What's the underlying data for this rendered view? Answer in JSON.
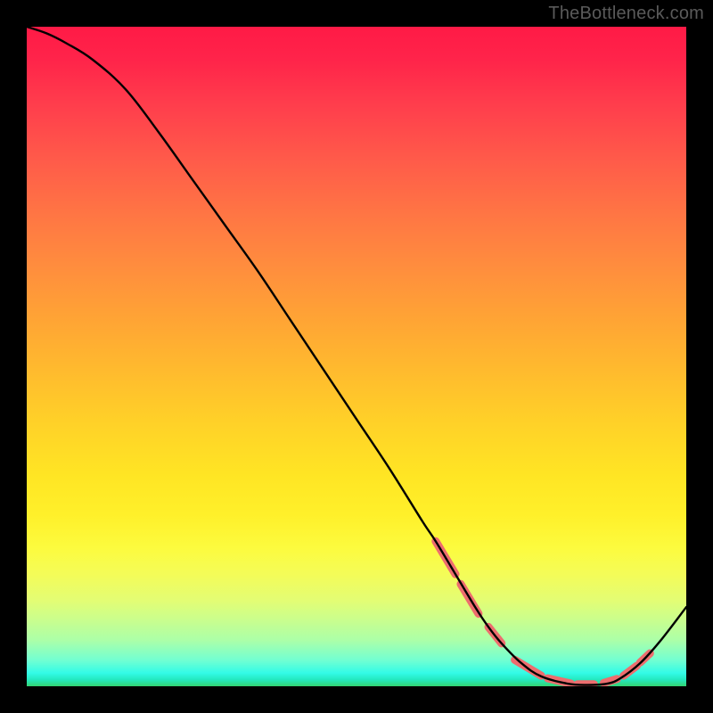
{
  "attribution": "TheBottleneck.com",
  "chart_data": {
    "type": "line",
    "title": "",
    "xlabel": "",
    "ylabel": "",
    "xlim": [
      0,
      100
    ],
    "ylim": [
      0,
      100
    ],
    "series": [
      {
        "name": "curve",
        "x": [
          0,
          3,
          6,
          10,
          15,
          20,
          25,
          30,
          35,
          40,
          45,
          50,
          55,
          60,
          62,
          65,
          68,
          70,
          72,
          75,
          78,
          82,
          85,
          88,
          90,
          93,
          96,
          100
        ],
        "y": [
          100,
          99,
          97.5,
          95,
          90.5,
          84,
          77,
          70,
          63,
          55.5,
          48,
          40.5,
          33,
          25,
          22,
          17,
          12,
          9,
          6.5,
          3.5,
          1.5,
          0.4,
          0.2,
          0.4,
          1.2,
          3.5,
          6.8,
          12
        ]
      }
    ],
    "highlight": {
      "color": "#ed6d6e",
      "thickness": 9,
      "segments": [
        {
          "x": [
            62,
            65
          ],
          "y": [
            22,
            17
          ]
        },
        {
          "x": [
            65.8,
            68.5
          ],
          "y": [
            15.5,
            11
          ]
        },
        {
          "x": [
            70,
            72
          ],
          "y": [
            9,
            6.5
          ]
        },
        {
          "x": [
            74,
            78
          ],
          "y": [
            4,
            1.6
          ]
        },
        {
          "x": [
            79,
            82.5
          ],
          "y": [
            1.2,
            0.4
          ]
        },
        {
          "x": [
            83.5,
            86
          ],
          "y": [
            0.3,
            0.3
          ]
        },
        {
          "x": [
            87.5,
            89.5
          ],
          "y": [
            0.5,
            1.1
          ]
        },
        {
          "x": [
            90.5,
            92.5
          ],
          "y": [
            1.6,
            3.1
          ]
        },
        {
          "x": [
            93,
            94.5
          ],
          "y": [
            3.6,
            5.0
          ]
        }
      ]
    }
  }
}
